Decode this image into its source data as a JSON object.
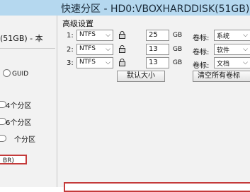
{
  "window": {
    "title": "快速分区 - HD0:VBOXHARDDISK(51GB)"
  },
  "left": {
    "disk_label": "(51GB) - 本",
    "guid_label": "GUID",
    "partition_options": [
      "4个分区",
      "6个分区",
      "个分区"
    ],
    "mbr_label": "BR)"
  },
  "advanced": {
    "title": "高级设置",
    "rows": [
      {
        "num": "1:",
        "fs": "NTFS",
        "size": "25",
        "unit": "GB",
        "label_title": "卷标:",
        "label_value": "系统"
      },
      {
        "num": "2:",
        "fs": "NTFS",
        "size": "13",
        "unit": "GB",
        "label_title": "卷标:",
        "label_value": "软件"
      },
      {
        "num": "3:",
        "fs": "NTFS",
        "size": "13",
        "unit": "GB",
        "label_title": "卷标:",
        "label_value": "文档"
      }
    ],
    "default_size_button": "默认大小",
    "clear_labels_button": "清空所有卷标"
  },
  "icons": {
    "lock": "lock-icon",
    "unlock": "unlock-icon",
    "dropdown": "chevron-down-icon"
  }
}
